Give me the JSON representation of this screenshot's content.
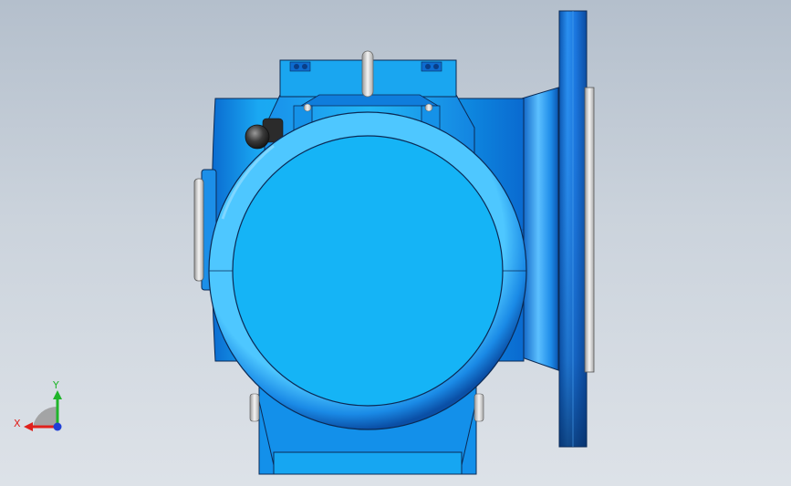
{
  "viewport": {
    "background_top": "#b4bfcc",
    "background_bottom": "#dde2e8"
  },
  "model": {
    "color_main": "#16b4f5",
    "color_dark": "#0a5eb8",
    "color_edge": "#0b2a55",
    "color_metal": "#e8e8e8"
  },
  "triad": {
    "x_label": "X",
    "y_label": "Y",
    "x_color": "#e0201c",
    "y_color": "#1fb52a",
    "z_color": "#1f3fd6"
  }
}
